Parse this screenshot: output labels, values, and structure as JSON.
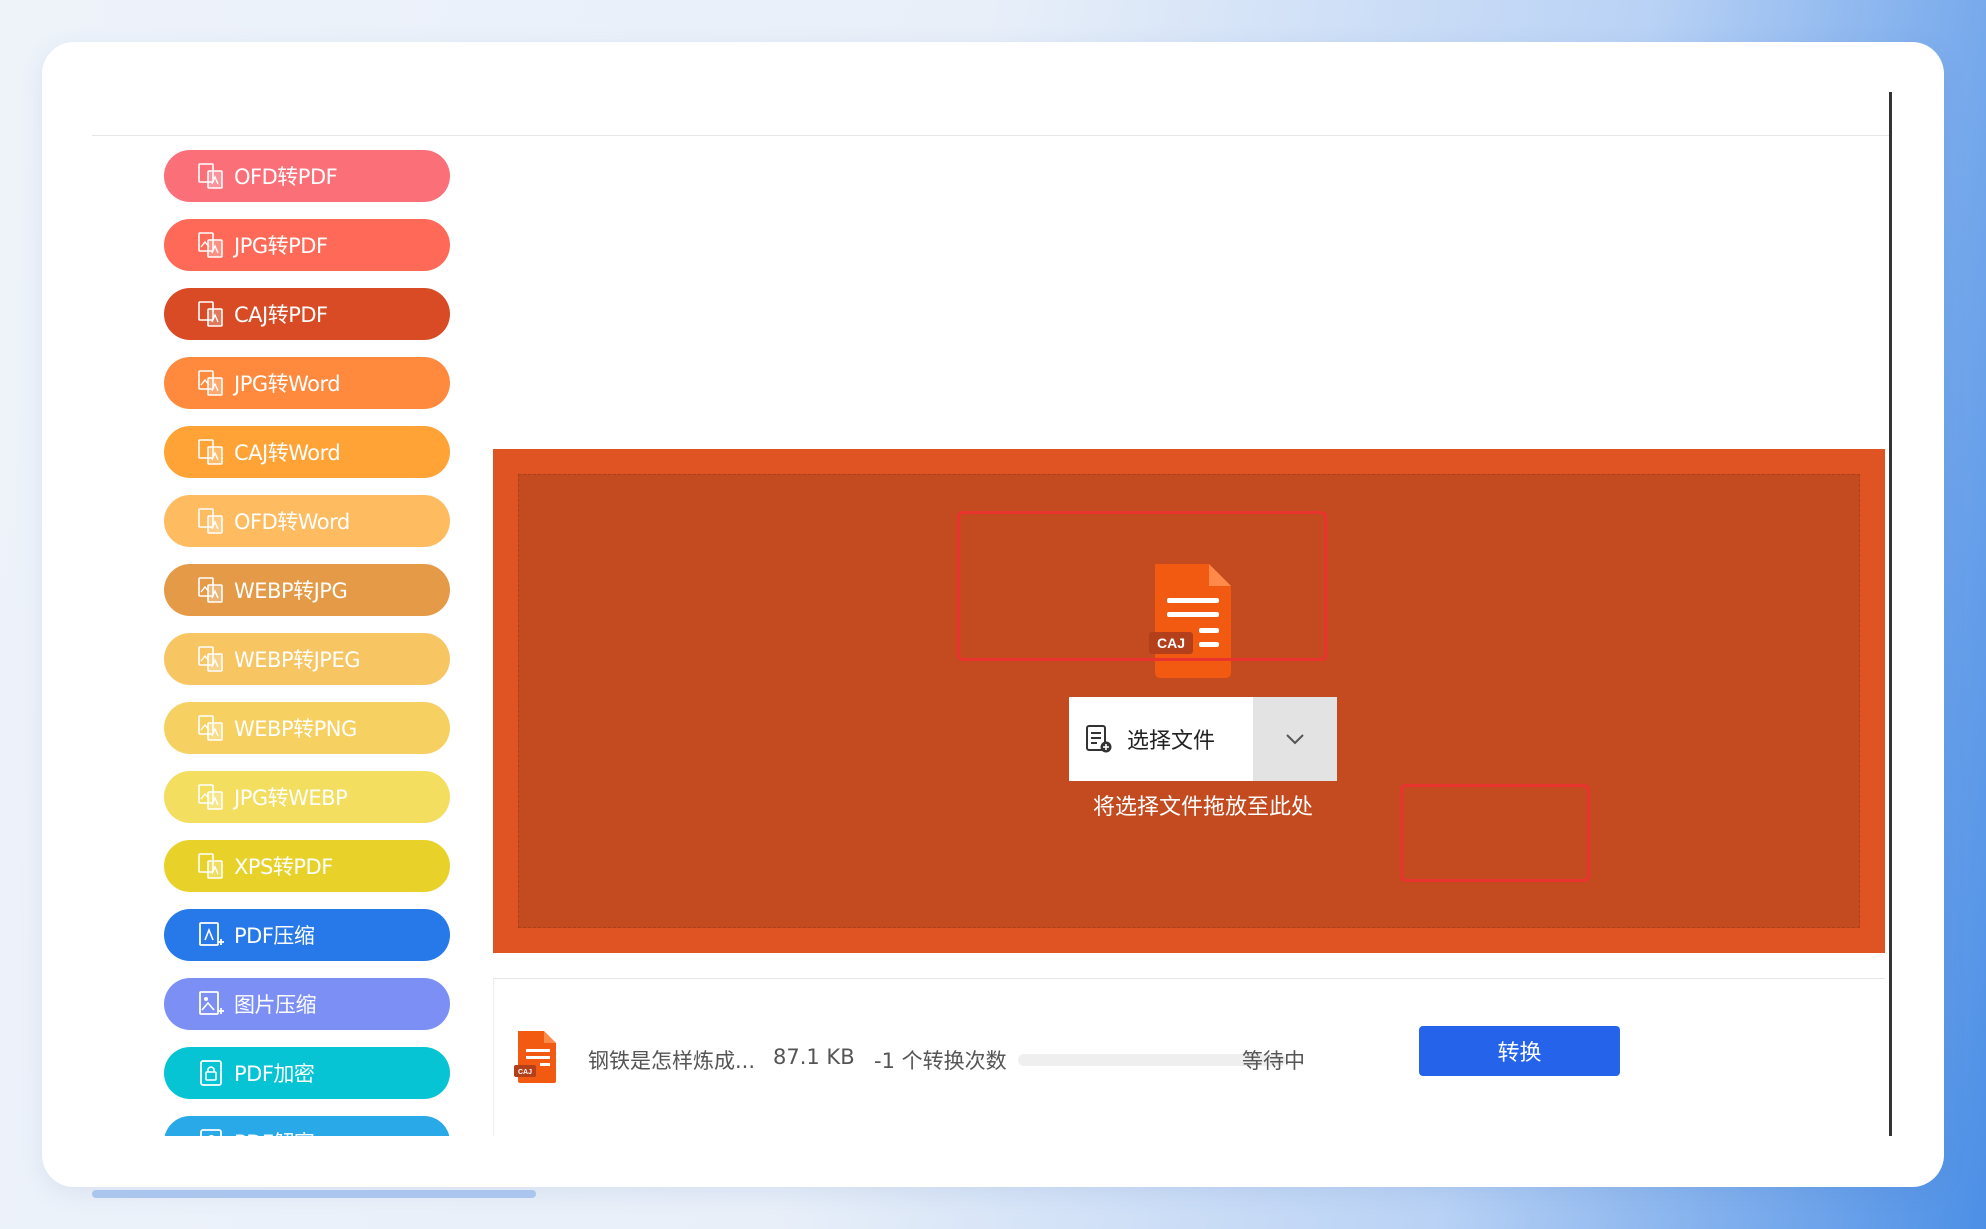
{
  "sidebar": {
    "items": [
      {
        "label": "OFD转PDF",
        "color": "#fb6f78",
        "icon": "doc-convert-icon"
      },
      {
        "label": "JPG转PDF",
        "color": "#ff6a58",
        "icon": "image-convert-icon"
      },
      {
        "label": "CAJ转PDF",
        "color": "#d94b25",
        "icon": "doc-convert-icon"
      },
      {
        "label": "JPG转Word",
        "color": "#ff8a3d",
        "icon": "image-convert-icon"
      },
      {
        "label": "CAJ转Word",
        "color": "#ffa336",
        "icon": "doc-convert-icon"
      },
      {
        "label": "OFD转Word",
        "color": "#ffbb5f",
        "icon": "doc-convert-icon"
      },
      {
        "label": "WEBP转JPG",
        "color": "#e59a47",
        "icon": "image-convert-icon"
      },
      {
        "label": "WEBP转JPEG",
        "color": "#f8c563",
        "icon": "image-convert-icon"
      },
      {
        "label": "WEBP转PNG",
        "color": "#f6d161",
        "icon": "image-convert-icon"
      },
      {
        "label": "JPG转WEBP",
        "color": "#f3de5f",
        "icon": "image-convert-icon"
      },
      {
        "label": "XPS转PDF",
        "color": "#e8d22a",
        "icon": "doc-convert-icon"
      },
      {
        "label": "PDF压缩",
        "color": "#2778e8",
        "icon": "compress-icon"
      },
      {
        "label": "图片压缩",
        "color": "#7c8ff5",
        "icon": "image-compress-icon"
      },
      {
        "label": "PDF加密",
        "color": "#06c4d4",
        "icon": "lock-icon"
      },
      {
        "label": "PDF解密",
        "color": "#2aa9e8",
        "icon": "unlock-icon"
      }
    ]
  },
  "upload": {
    "choose_label": "选择文件",
    "drop_hint": "将选择文件拖放至此处",
    "file_badge": "CAJ",
    "accent": "#e05322"
  },
  "file": {
    "name": "钢铁是怎样炼成...",
    "size": "87.1 KB",
    "count": "-1 个转换次数",
    "status": "等待中",
    "progress": 0,
    "badge": "CAJ"
  },
  "actions": {
    "convert_label": "转换",
    "convert_color": "#2563eb"
  }
}
